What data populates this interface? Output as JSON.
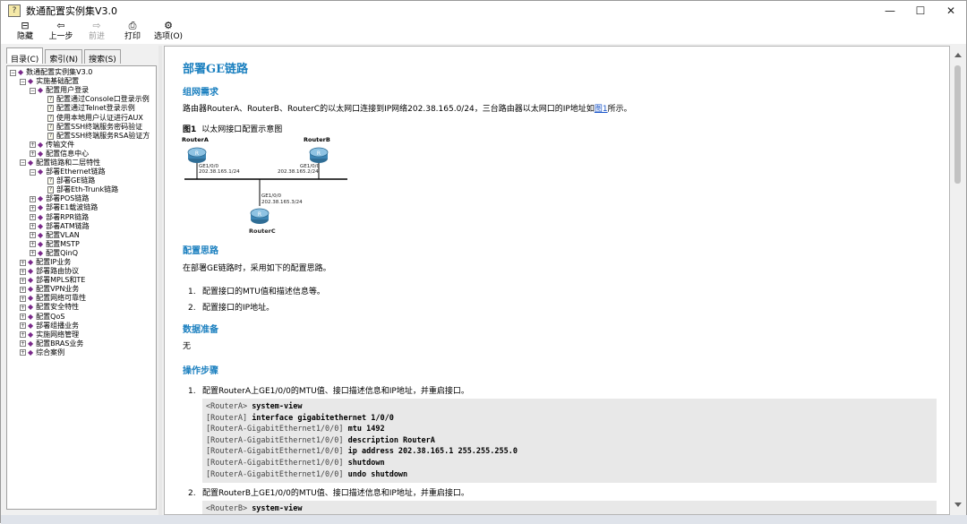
{
  "window": {
    "title": "数通配置实例集V3.0",
    "controls": [
      "—",
      "☐",
      "✕"
    ]
  },
  "toolbar": [
    {
      "label": "隐藏",
      "icon": "hide-icon",
      "glyph": "⊟",
      "enabled": true
    },
    {
      "label": "上一步",
      "icon": "back-icon",
      "glyph": "⇦",
      "enabled": true
    },
    {
      "label": "前进",
      "icon": "forward-icon",
      "glyph": "⇨",
      "enabled": false
    },
    {
      "label": "打印",
      "icon": "print-icon",
      "glyph": "⎙",
      "enabled": true
    },
    {
      "label": "选项(O)",
      "icon": "options-icon",
      "glyph": "⚙",
      "enabled": true
    }
  ],
  "tabs": [
    {
      "label": "目录(C)",
      "active": true
    },
    {
      "label": "索引(N)",
      "active": false
    },
    {
      "label": "搜索(S)",
      "active": false
    }
  ],
  "tree": [
    {
      "level": 0,
      "exp": "−",
      "type": "book",
      "label": "数通配置实例集V3.0"
    },
    {
      "level": 1,
      "exp": "−",
      "type": "book",
      "label": "实施基础配置"
    },
    {
      "level": 2,
      "exp": "−",
      "type": "book",
      "label": "配置用户登录"
    },
    {
      "level": 3,
      "exp": "",
      "type": "page",
      "label": "配置通过Console口登录示例"
    },
    {
      "level": 3,
      "exp": "",
      "type": "page",
      "label": "配置通过Telnet登录示例"
    },
    {
      "level": 3,
      "exp": "",
      "type": "page",
      "label": "使用本地用户认证进行AUX"
    },
    {
      "level": 3,
      "exp": "",
      "type": "page",
      "label": "配置SSH终端服务密码验证"
    },
    {
      "level": 3,
      "exp": "",
      "type": "page",
      "label": "配置SSH终端服务RSA验证方"
    },
    {
      "level": 2,
      "exp": "+",
      "type": "book",
      "label": "传输文件"
    },
    {
      "level": 2,
      "exp": "+",
      "type": "book",
      "label": "配置信息中心"
    },
    {
      "level": 1,
      "exp": "−",
      "type": "book",
      "label": "配置链路和二层特性"
    },
    {
      "level": 2,
      "exp": "−",
      "type": "book",
      "label": "部署Ethernet链路"
    },
    {
      "level": 3,
      "exp": "",
      "type": "page",
      "label": "部署GE链路"
    },
    {
      "level": 3,
      "exp": "",
      "type": "page",
      "label": "部署Eth-Trunk链路"
    },
    {
      "level": 2,
      "exp": "+",
      "type": "book",
      "label": "部署POS链路"
    },
    {
      "level": 2,
      "exp": "+",
      "type": "book",
      "label": "部署E1载波链路"
    },
    {
      "level": 2,
      "exp": "+",
      "type": "book",
      "label": "部署RPR链路"
    },
    {
      "level": 2,
      "exp": "+",
      "type": "book",
      "label": "部署ATM链路"
    },
    {
      "level": 2,
      "exp": "+",
      "type": "book",
      "label": "配置VLAN"
    },
    {
      "level": 2,
      "exp": "+",
      "type": "book",
      "label": "配置MSTP"
    },
    {
      "level": 2,
      "exp": "+",
      "type": "book",
      "label": "配置QinQ"
    },
    {
      "level": 1,
      "exp": "+",
      "type": "book",
      "label": "配置IP业务"
    },
    {
      "level": 1,
      "exp": "+",
      "type": "book",
      "label": "部署路由协议"
    },
    {
      "level": 1,
      "exp": "+",
      "type": "book",
      "label": "部署MPLS和TE"
    },
    {
      "level": 1,
      "exp": "+",
      "type": "book",
      "label": "配置VPN业务"
    },
    {
      "level": 1,
      "exp": "+",
      "type": "book",
      "label": "配置网络可靠性"
    },
    {
      "level": 1,
      "exp": "+",
      "type": "book",
      "label": "配置安全特性"
    },
    {
      "level": 1,
      "exp": "+",
      "type": "book",
      "label": "配置QoS"
    },
    {
      "level": 1,
      "exp": "+",
      "type": "book",
      "label": "部署组播业务"
    },
    {
      "level": 1,
      "exp": "+",
      "type": "book",
      "label": "实施网络管理"
    },
    {
      "level": 1,
      "exp": "+",
      "type": "book",
      "label": "配置BRAS业务"
    },
    {
      "level": 1,
      "exp": "+",
      "type": "book",
      "label": "综合案例"
    }
  ],
  "content": {
    "title": "部署GE链路",
    "sec_requirement": "组网需求",
    "requirement_text": "路由器RouterA、RouterB、RouterC的以太网口连接到IP网络202.38.165.0/24，三台路由器以太网口的IP地址如",
    "requirement_link": "图1",
    "requirement_tail": "所示。",
    "fig_num": "图1",
    "fig_caption": "以太网接口配置示意图",
    "diagram": {
      "routerA": "RouterA",
      "routerB": "RouterB",
      "routerC": "RouterC",
      "a_if": "GE1/0/0",
      "a_ip": "202.38.165.1/24",
      "b_if": "GE1/0/0",
      "b_ip": "202.38.165.2/24",
      "c_if": "GE1/0/0",
      "c_ip": "202.38.165.3/24"
    },
    "sec_approach": "配置思路",
    "approach_text": "在部署GE链路时，采用如下的配置思路。",
    "approach_items": [
      "配置接口的MTU值和描述信息等。",
      "配置接口的IP地址。"
    ],
    "sec_data": "数据准备",
    "data_text": "无",
    "sec_steps": "操作步骤",
    "step1": "配置RouterA上GE1/0/0的MTU值、接口描述信息和IP地址，并重启接口。",
    "code1": [
      {
        "prompt": "<RouterA> ",
        "cmd": "system-view"
      },
      {
        "prompt": "[RouterA] ",
        "cmd": "interface gigabitethernet 1/0/0"
      },
      {
        "prompt": "[RouterA-GigabitEthernet1/0/0] ",
        "cmd": "mtu 1492"
      },
      {
        "prompt": "[RouterA-GigabitEthernet1/0/0] ",
        "cmd": "description RouterA"
      },
      {
        "prompt": "[RouterA-GigabitEthernet1/0/0] ",
        "cmd": "ip address 202.38.165.1 255.255.255.0"
      },
      {
        "prompt": "[RouterA-GigabitEthernet1/0/0] ",
        "cmd": "shutdown"
      },
      {
        "prompt": "[RouterA-GigabitEthernet1/0/0] ",
        "cmd": "undo shutdown"
      }
    ],
    "step2": "配置RouterB上GE1/0/0的MTU值、接口描述信息和IP地址，并重启接口。",
    "code2_prompt": "<RouterB> ",
    "code2_cmd": "system-view"
  },
  "colors": {
    "heading": "#1a7fbf",
    "link": "#1a56c9",
    "code_bg": "#e8e8e8"
  }
}
